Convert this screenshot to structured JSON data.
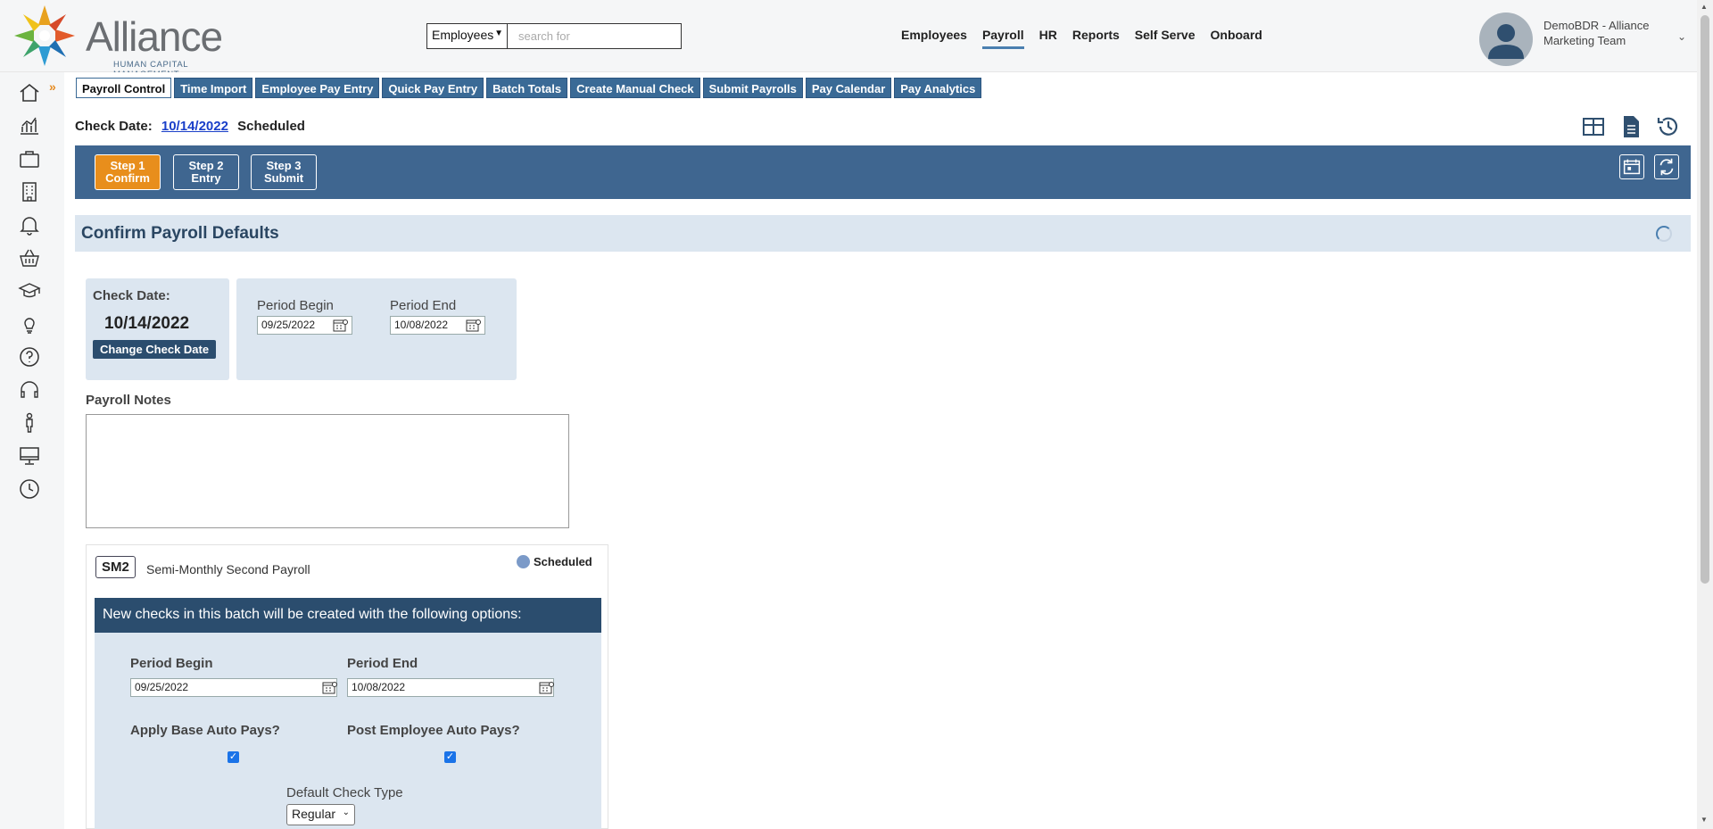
{
  "brand": {
    "name": "Alliance",
    "tagline": "HUMAN CAPITAL MANAGEMENT"
  },
  "search": {
    "scope": "Employees",
    "placeholder": "search for"
  },
  "topnav": [
    {
      "label": "Employees",
      "active": false
    },
    {
      "label": "Payroll",
      "active": true
    },
    {
      "label": "HR",
      "active": false
    },
    {
      "label": "Reports",
      "active": false
    },
    {
      "label": "Self Serve",
      "active": false
    },
    {
      "label": "Onboard",
      "active": false
    }
  ],
  "user": {
    "name": "DemoBDR - Alliance Marketing Team"
  },
  "rail_icons": [
    "home-icon",
    "analytics-icon",
    "briefcase-icon",
    "building-icon",
    "bell-icon",
    "basket-icon",
    "graduation-cap-icon",
    "lightbulb-icon",
    "help-icon",
    "headset-icon",
    "person-icon",
    "monitor-icon",
    "clock-icon"
  ],
  "subnav": [
    {
      "label": "Payroll Control",
      "active": true
    },
    {
      "label": "Time Import",
      "active": false
    },
    {
      "label": "Employee Pay Entry",
      "active": false
    },
    {
      "label": "Quick Pay Entry",
      "active": false
    },
    {
      "label": "Batch Totals",
      "active": false
    },
    {
      "label": "Create Manual Check",
      "active": false
    },
    {
      "label": "Submit Payrolls",
      "active": false
    },
    {
      "label": "Pay Calendar",
      "active": false
    },
    {
      "label": "Pay Analytics",
      "active": false
    }
  ],
  "check_line": {
    "label": "Check Date:",
    "date": "10/14/2022",
    "status": "Scheduled"
  },
  "steps": [
    {
      "line1": "Step 1",
      "line2": "Confirm",
      "active": true
    },
    {
      "line1": "Step 2",
      "line2": "Entry",
      "active": false
    },
    {
      "line1": "Step 3",
      "line2": "Submit",
      "active": false
    }
  ],
  "section": {
    "title": "Confirm Payroll Defaults"
  },
  "check_card": {
    "label": "Check Date:",
    "date": "10/14/2022",
    "button": "Change Check Date"
  },
  "period_card": {
    "begin_label": "Period Begin",
    "begin_value": "09/25/2022",
    "end_label": "Period End",
    "end_value": "10/08/2022"
  },
  "notes": {
    "label": "Payroll Notes",
    "value": ""
  },
  "batch": {
    "code": "SM2",
    "name": "Semi-Monthly Second Payroll",
    "status": "Scheduled",
    "banner": "New checks in this batch will be created with the following options:",
    "begin_label": "Period Begin",
    "begin_value": "09/25/2022",
    "end_label": "Period End",
    "end_value": "10/08/2022",
    "apply_base_label": "Apply Base Auto Pays?",
    "apply_base_checked": true,
    "post_emp_label": "Post Employee Auto Pays?",
    "post_emp_checked": true,
    "check_type_label": "Default Check Type",
    "check_type_value": "Regular"
  },
  "colors": {
    "primary": "#3f6690",
    "accent": "#e88e1c",
    "panel": "#dce6f0",
    "dark": "#2b4d6e"
  }
}
